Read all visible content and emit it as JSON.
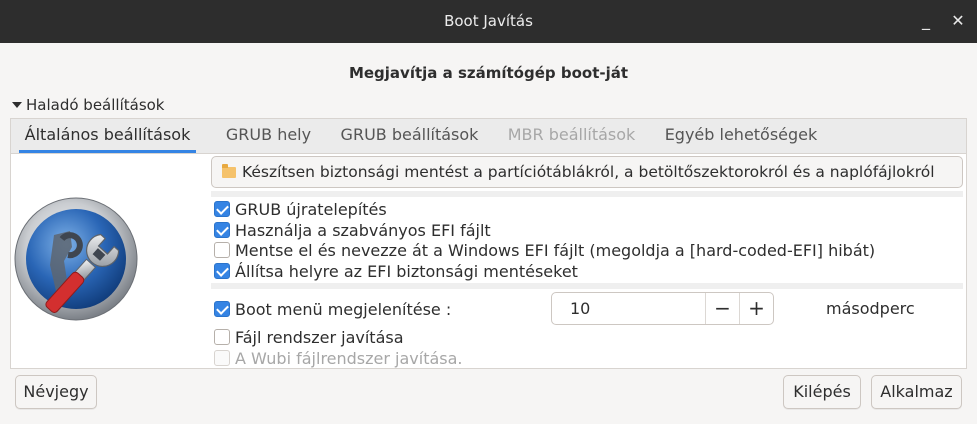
{
  "window": {
    "title": "Boot Javítás",
    "minimize_glyph": "_",
    "close_glyph": "✕"
  },
  "heading": "Megjavítja a számítógép boot-ját",
  "expander": {
    "label": "Haladó beállítások",
    "expanded": true
  },
  "tabs": [
    {
      "label": "Általános beállítások",
      "active": true,
      "enabled": true
    },
    {
      "label": "GRUB hely",
      "active": false,
      "enabled": true
    },
    {
      "label": "GRUB beállítások",
      "active": false,
      "enabled": true
    },
    {
      "label": "MBR beállítások",
      "active": false,
      "enabled": false
    },
    {
      "label": "Egyéb lehetőségek",
      "active": false,
      "enabled": true
    }
  ],
  "backup_button": {
    "label": "Készítsen biztonsági mentést a partíciótáblákról, a betöltőszektorokról és a naplófájlokról",
    "icon": "folder-icon"
  },
  "options": [
    {
      "label": "GRUB újratelepítés",
      "checked": true,
      "enabled": true
    },
    {
      "label": "Használja a szabványos EFI fájlt",
      "checked": true,
      "enabled": true
    },
    {
      "label": "Mentse el és nevezze át a Windows EFI fájlt (megoldja a [hard-coded-EFI] hibát)",
      "checked": false,
      "enabled": true
    },
    {
      "label": "Állítsa helyre az EFI biztonsági mentéseket",
      "checked": true,
      "enabled": true
    }
  ],
  "boot_menu": {
    "label": "Boot menü megjelenítése :",
    "checked": true,
    "value": "10",
    "unit": "másodperc",
    "minus": "−",
    "plus": "+"
  },
  "fs_options": [
    {
      "label": "Fájl rendszer javítása",
      "checked": false,
      "enabled": true
    },
    {
      "label": "A Wubi fájlrendszer javítása.",
      "checked": false,
      "enabled": false
    }
  ],
  "footer": {
    "about": "Névjegy",
    "exit": "Kilépés",
    "apply": "Alkalmaz"
  },
  "colors": {
    "accent": "#3584e4",
    "titlebar": "#2d2d2d",
    "background": "#f6f5f4"
  }
}
